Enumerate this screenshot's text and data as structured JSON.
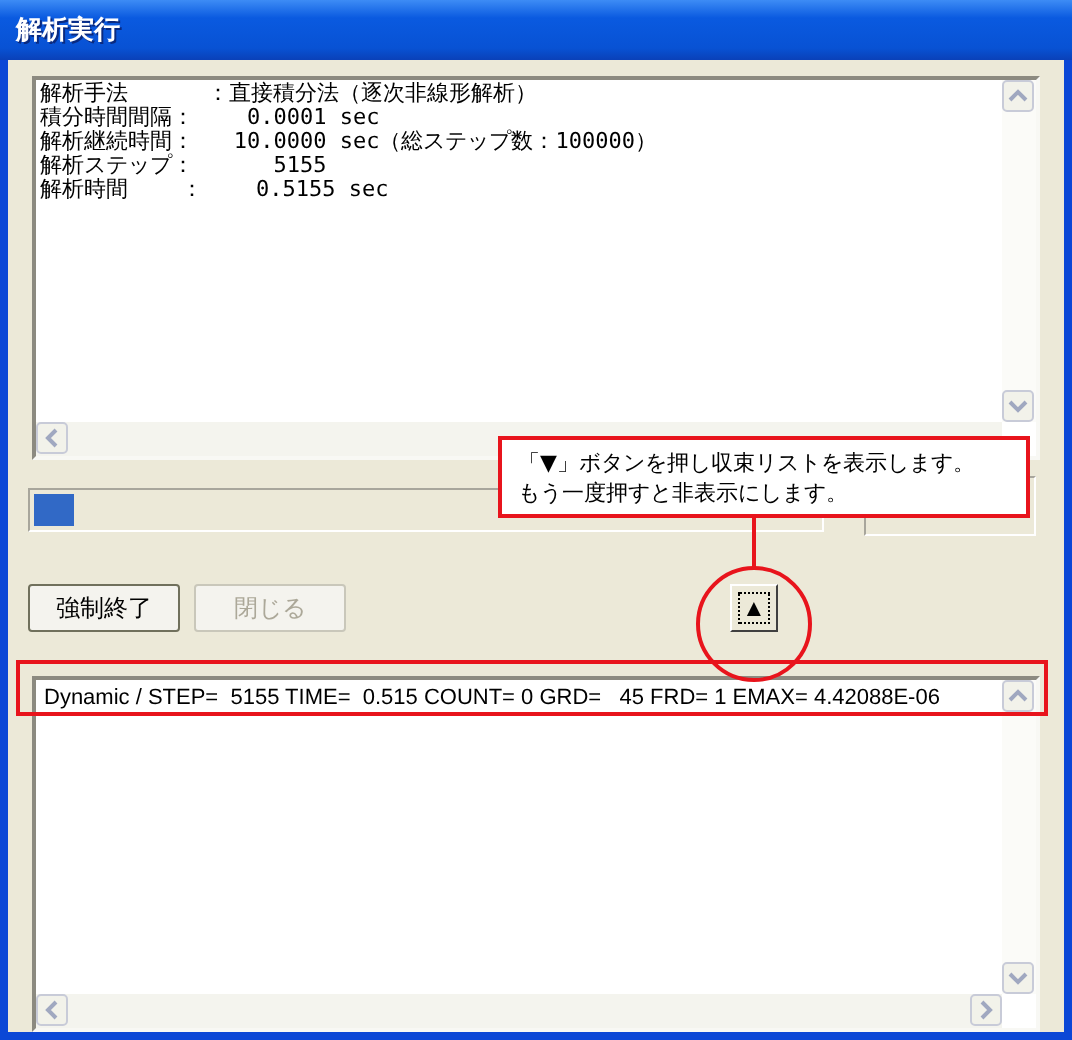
{
  "window": {
    "title": "解析実行"
  },
  "log": {
    "lines": [
      "解析手法      ：直接積分法（逐次非線形解析）",
      "積分時間間隔：    0.0001 sec",
      "解析継続時間：   10.0000 sec（総ステップ数：100000）",
      "解析ステップ：      5155",
      "解析時間    ：    0.5155 sec"
    ]
  },
  "progress": {
    "level": 0.05
  },
  "buttons": [
    {
      "label": "強制終了",
      "disabled": false
    },
    {
      "label": "閉じる",
      "disabled": true
    }
  ],
  "toggle_button": {
    "symbol": "▲"
  },
  "convergence_list": {
    "rows": [
      "Dynamic / STEP=  5155 TIME=  0.515 COUNT= 0 GRD=   45 FRD= 1 EMAX= 4.42088E-06"
    ]
  },
  "callout": {
    "lines": [
      "「▼」ボタンを押し収束リストを表示します。",
      "もう一度押すと非表示にします。"
    ]
  }
}
